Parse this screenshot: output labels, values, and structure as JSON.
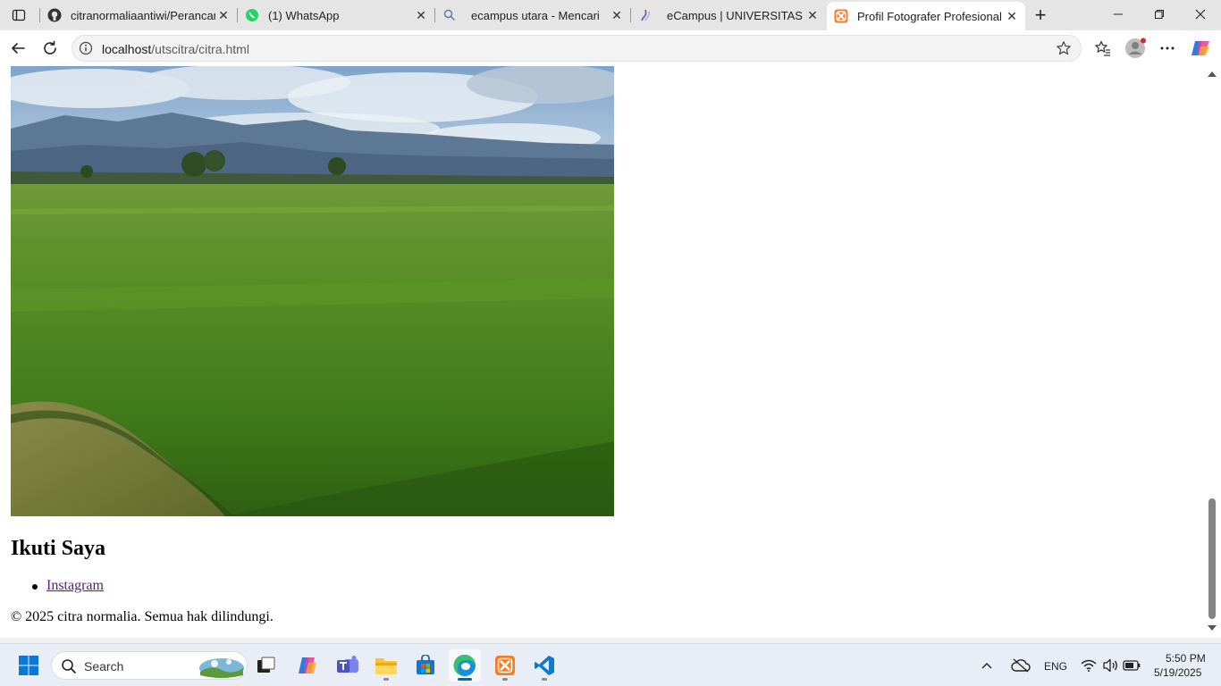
{
  "browser": {
    "tabs": [
      {
        "title": "citranormaliaantiwi/Perancang",
        "icon": "github-icon"
      },
      {
        "title": "(1) WhatsApp",
        "icon": "whatsapp-icon"
      },
      {
        "title": "ecampus utara - Mencari",
        "icon": "search-icon"
      },
      {
        "title": "eCampus | UNIVERSITAS TANG",
        "icon": "ecampus-icon"
      },
      {
        "title": "Profil Fotografer Profesional",
        "icon": "xampp-icon",
        "active": true
      }
    ],
    "url_host": "localhost",
    "url_path": "/utscitra/citra.html"
  },
  "page": {
    "photo_alt": "",
    "follow_heading": "Ikuti Saya",
    "links": [
      "Instagram"
    ],
    "footer": "© 2025 citra normalia. Semua hak dilindungi."
  },
  "taskbar": {
    "search_label": "Search",
    "language": "ENG",
    "time": "5:50 PM",
    "date": "5/19/2025"
  }
}
